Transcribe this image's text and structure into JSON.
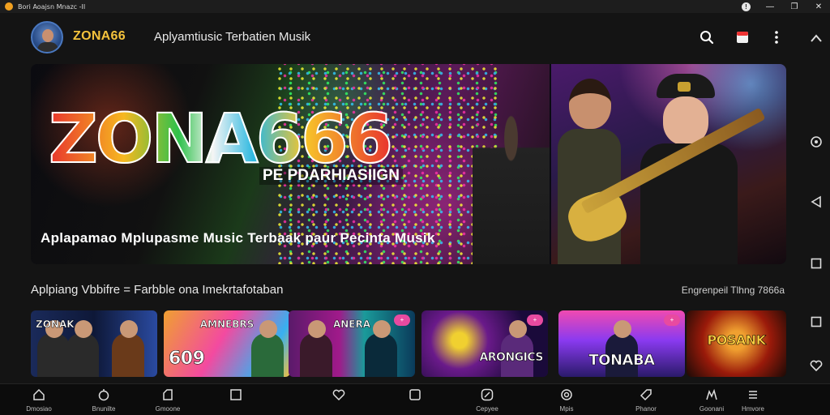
{
  "window": {
    "title": "Bori Aoajsn Mnazc  -II",
    "controls": [
      "info-icon",
      "minimize-icon",
      "maximize-icon",
      "close-icon"
    ]
  },
  "header": {
    "brand": "ZONA66",
    "subtitle": "Aplyamtiusic Terbatien Musik",
    "icons": [
      "search-icon",
      "bookmark-icon",
      "more-vert-icon"
    ]
  },
  "hero": {
    "logo": "ZONA666",
    "badge": "PE PDARHIASIIGN",
    "tagline": "Aplapamao Mplupasme Music Terbaak paur Pecinta Musik"
  },
  "section": {
    "title": "Aplpiang Vbbifre = Farbble ona Imekrtafotaban",
    "link": "Engrenpeil Tlhng 7866a"
  },
  "cards": [
    {
      "top": "",
      "label": "ZONAK",
      "pill": ""
    },
    {
      "top": "AMNEBRS",
      "label": "609",
      "pill": ""
    },
    {
      "top": "ANERA",
      "label": "",
      "pill": "+"
    },
    {
      "top": "",
      "label": "ARONGICS",
      "pill": "+"
    },
    {
      "top": "",
      "label": "TONABA",
      "pill": "+"
    },
    {
      "top": "",
      "label": "POSANK",
      "pill": ""
    }
  ],
  "rail": [
    "chevron-up-icon",
    "cog-icon",
    "back-icon",
    "square-icon",
    "square-icon",
    "heart-icon"
  ],
  "bottom_nav": [
    {
      "icon": "home-icon",
      "label": "Dmosiao"
    },
    {
      "icon": "bell-icon",
      "label": "Bnunilte"
    },
    {
      "icon": "bag-icon",
      "label": "Gmoone"
    },
    {
      "icon": "square-icon",
      "label": ""
    },
    {
      "icon": "heart-icon",
      "label": ""
    },
    {
      "icon": "square-icon",
      "label": ""
    },
    {
      "icon": "compass-icon",
      "label": "Cepyee"
    },
    {
      "icon": "ring-icon",
      "label": "Mpis"
    },
    {
      "icon": "tag-icon",
      "label": "Phanor"
    },
    {
      "icon": "chart-icon",
      "label": "Goonani"
    },
    {
      "icon": "list-icon",
      "label": "Hmvore"
    }
  ],
  "colors": {
    "background": "#141414",
    "brand": "#f4c23c",
    "accent": "#e84aa0"
  }
}
